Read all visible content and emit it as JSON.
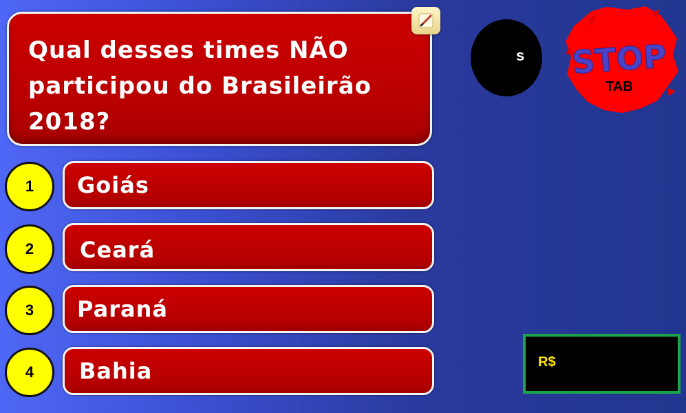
{
  "question": {
    "text": "Qual desses times NÃO\nparticipou do Brasileirão 2018?"
  },
  "tools": {
    "edit_icon": "pencil-icon"
  },
  "answers": [
    {
      "number": "1",
      "label": "Goiás"
    },
    {
      "number": "2",
      "label": "Ceará"
    },
    {
      "number": "3",
      "label": "Paraná"
    },
    {
      "number": "4",
      "label": "Bahia"
    }
  ],
  "timer": {
    "text": "s"
  },
  "stop_button": {
    "title": "STOP",
    "key_hint": "TAB"
  },
  "prize": {
    "label": "R$"
  },
  "colors": {
    "answer_red": "#c00000",
    "number_yellow": "#ffff00",
    "prize_border": "#1aa54a",
    "prize_text": "#ffe600",
    "stop_red": "#ff0000",
    "stop_letters": "#4a43c8"
  }
}
